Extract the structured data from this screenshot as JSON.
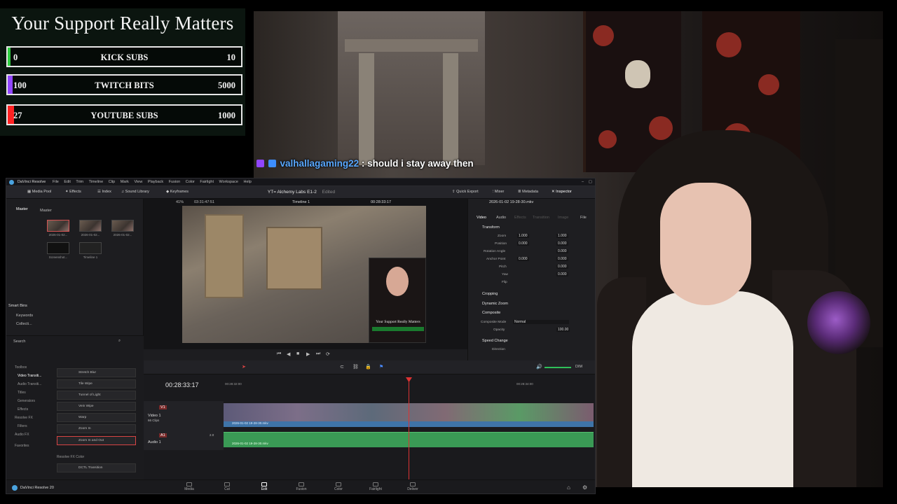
{
  "overlay": {
    "title": "Your Support Really Matters",
    "goals": [
      {
        "current": "0",
        "label": "KICK SUBS",
        "target": "10",
        "progress": 0.0,
        "color": "#2ecc40"
      },
      {
        "current": "100",
        "label": "TWITCH BITS",
        "target": "5000",
        "progress": 0.02,
        "color": "#9146ff"
      },
      {
        "current": "27",
        "label": "YOUTUBE SUBS",
        "target": "1000",
        "progress": 0.027,
        "color": "#ff2222"
      }
    ]
  },
  "chat": {
    "username": "valhallagaming22",
    "separator": ":",
    "message": "should i stay away then",
    "badges": [
      "twitch-badge",
      "crown-badge"
    ]
  },
  "resolve": {
    "app_name": "DaVinci Resolve",
    "menu": [
      "File",
      "Edit",
      "Trim",
      "Timeline",
      "Clip",
      "Mark",
      "View",
      "Playback",
      "Fusion",
      "Color",
      "Fairlight",
      "Workspace",
      "Help"
    ],
    "toolbar": {
      "media_pool": "Media Pool",
      "effects": "Effects",
      "index": "Index",
      "sound_library": "Sound Library",
      "keyframes": "Keyframes",
      "project_title": "YT= Alchemy Labs E1-2",
      "edited": "Edited",
      "quick_export": "Quick Export",
      "mixer": "Mixer",
      "metadata": "Metadata",
      "inspector": "Inspector"
    },
    "media_pool": {
      "bin_master": "Master",
      "bin_tab": "Master",
      "clips": [
        {
          "name": "2026-01-02..."
        },
        {
          "name": "2026-01-02..."
        },
        {
          "name": "2026-01-02..."
        },
        {
          "name": "Screenshot..."
        },
        {
          "name": "Timeline 1"
        }
      ],
      "smart_bins": "Smart Bins",
      "keywords": "Keywords",
      "collections": "Collecti..."
    },
    "viewer": {
      "zoom": "41%",
      "duration": "03:31:47:51",
      "timeline_name": "Timeline 1",
      "timecode": "00:28:33:17",
      "pip_title": "Your Support Really Matters"
    },
    "inspector": {
      "clip_name": "2026-01-02 19-28-30.mkv",
      "tabs": [
        "Video",
        "Audio",
        "Effects",
        "Transition",
        "Image",
        "File"
      ],
      "transform": "Transform",
      "zoom_label": "Zoom",
      "zoom_x": "1.000",
      "zoom_y": "1.000",
      "position_label": "Position",
      "position_x": "0.000",
      "position_y": "0.000",
      "rotation_label": "Rotation Angle",
      "rotation": "0.000",
      "anchor_label": "Anchor Point",
      "anchor_x": "0.000",
      "anchor_y": "0.000",
      "pitch_label": "Pitch",
      "pitch": "0.000",
      "yaw_label": "Yaw",
      "yaw": "0.000",
      "flip_label": "Flip",
      "cropping": "Cropping",
      "dynamic_zoom": "Dynamic Zoom",
      "composite": "Composite",
      "composite_mode_label": "Composite Mode",
      "composite_mode": "Normal",
      "opacity_label": "Opacity",
      "opacity": "100.00",
      "speed_change": "Speed Change",
      "direction_label": "Direction"
    },
    "effects": {
      "search_placeholder": "Search",
      "tree": [
        "Toolbox",
        "Video Transiti...",
        "Audio Transiti...",
        "Titles",
        "Generators",
        "Effects",
        "Resolve FX",
        "Filters",
        "Audio FX",
        "Favorites"
      ],
      "items": [
        "Stretch Blur",
        "Tile Wipe",
        "Tunnel of Light",
        "Vein Wipe",
        "Warp",
        "Zoom In",
        "Zoom In and Out"
      ],
      "resolve_fx_color": "Resolve FX Color",
      "dctl": "DCTL Transition"
    },
    "timeline": {
      "timecode": "00:28:33:17",
      "ruler_start": "00:28:32:00",
      "ruler_mid": "00:28:34:00",
      "v1_name": "V1",
      "v1_title": "Video 1",
      "v1_clips": "66 Clips",
      "a1_name": "A1",
      "a1_title": "Audio 1",
      "a1_level": "2.0",
      "clip_name": "2026-01-02 19-28-30.mkv",
      "audio_clip_name": "2026-01-02 19-28-30.mkv",
      "dim": "DIM"
    },
    "pages": [
      "Media",
      "Cut",
      "Edit",
      "Fusion",
      "Color",
      "Fairlight",
      "Deliver"
    ],
    "active_page": "Edit",
    "version": "DaVinci Resolve 20"
  }
}
